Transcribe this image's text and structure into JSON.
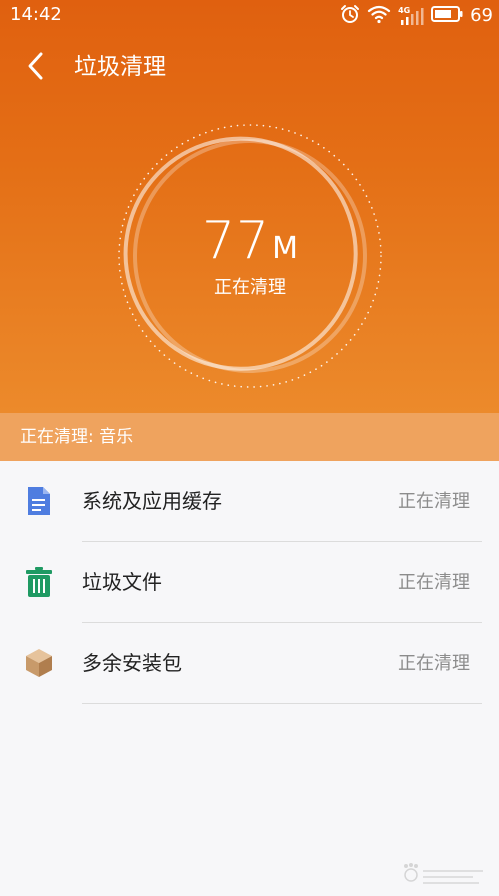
{
  "status_bar": {
    "time": "14:42",
    "network": "4G",
    "battery_percent": "69",
    "icons": [
      "alarm-icon",
      "wifi-icon",
      "cellular-signal-icon",
      "battery-icon"
    ]
  },
  "header": {
    "title": "垃圾清理",
    "back_icon": "chevron-left-icon"
  },
  "gauge": {
    "amount": "77",
    "unit": "M",
    "status": "正在清理"
  },
  "progress_banner": {
    "text": "正在清理: 音乐"
  },
  "items": [
    {
      "icon": "document-icon",
      "label": "系统及应用缓存",
      "status": "正在清理"
    },
    {
      "icon": "trash-bin-icon",
      "label": "垃圾文件",
      "status": "正在清理"
    },
    {
      "icon": "package-box-icon",
      "label": "多余安装包",
      "status": "正在清理"
    }
  ],
  "colors": {
    "hero_top": "#e0600f",
    "hero_bottom": "#ec8a2b",
    "banner": "#efa35e",
    "list_background": "#f7f7f9",
    "document_icon": "#4f7de0",
    "trash_icon": "#1f9a63",
    "package_icon": "#c89a6a",
    "status_text": "#8c8c8c"
  }
}
